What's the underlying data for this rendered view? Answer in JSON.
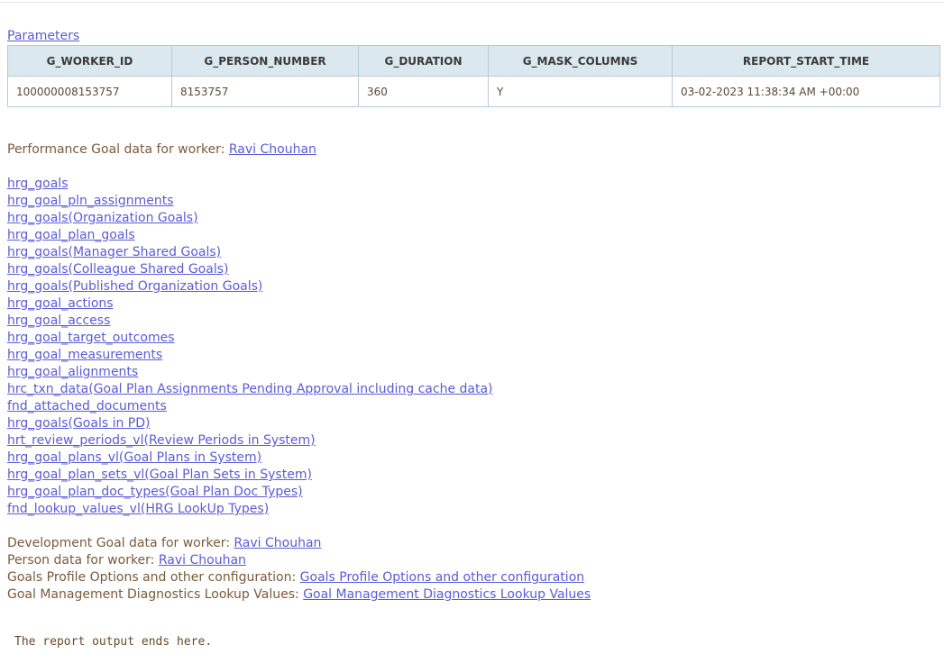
{
  "parameters_link": "Parameters",
  "params_table": {
    "headers": [
      "G_WORKER_ID",
      "G_PERSON_NUMBER",
      "G_DURATION",
      "G_MASK_COLUMNS",
      "REPORT_START_TIME"
    ],
    "row": [
      "100000008153757",
      "8153757",
      "360",
      "Y",
      "03-02-2023 11:38:34 AM +00:00"
    ]
  },
  "performance_goal": {
    "label": "Performance Goal data for worker: ",
    "worker_link": "Ravi Chouhan"
  },
  "goal_links": [
    "hrg_goals",
    "hrg_goal_pln_assignments",
    "hrg_goals(Organization Goals)",
    "hrg_goal_plan_goals",
    "hrg_goals(Manager Shared Goals)",
    "hrg_goals(Colleague Shared Goals)",
    "hrg_goals(Published Organization Goals)",
    "hrg_goal_actions",
    "hrg_goal_access",
    "hrg_goal_target_outcomes",
    "hrg_goal_measurements",
    "hrg_goal_alignments",
    "hrc_txn_data(Goal Plan Assignments Pending Approval including cache data)",
    "fnd_attached_documents",
    "hrg_goals(Goals in PD)",
    "hrt_review_periods_vl(Review Periods in System)",
    "hrg_goal_plans_vl(Goal Plans in System)",
    "hrg_goal_plan_sets_vl(Goal Plan Sets in System)",
    "hrg_goal_plan_doc_types(Goal Plan Doc Types)",
    "fnd_lookup_values_vl(HRG LookUp Types)"
  ],
  "development_goal": {
    "label": "Development Goal data for worker: ",
    "link": "Ravi Chouhan"
  },
  "person_data": {
    "label": "Person data for worker: ",
    "link": "Ravi Chouhan"
  },
  "profile_options": {
    "label": "Goals Profile Options and other configuration: ",
    "link": "Goals Profile Options and other configuration"
  },
  "diagnostics_lookup": {
    "label": "Goal Management Diagnostics Lookup Values: ",
    "link": "Goal Management Diagnostics Lookup Values"
  },
  "report_end": "The report output ends here."
}
